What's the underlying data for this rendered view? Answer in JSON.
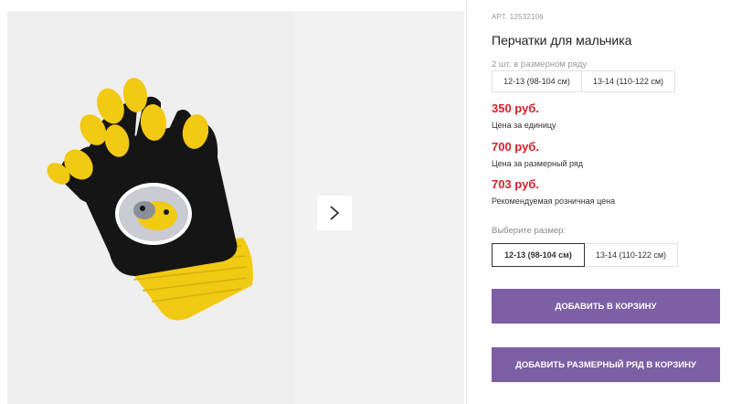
{
  "product": {
    "article": "АРТ. 12532106",
    "title": "Перчатки для мальчика",
    "pack": {
      "label": "2 шт. в размерном ряду",
      "sizes": [
        "12-13 (98-104 см)",
        "13-14 (110-122 см)"
      ]
    },
    "prices": [
      {
        "value": "350 руб.",
        "note": "Цена за единицу"
      },
      {
        "value": "700 руб.",
        "note": "Цена за размерный ряд"
      },
      {
        "value": "703 руб.",
        "note": "Рекомендуемая розничная цена"
      }
    ],
    "size_select": {
      "label": "Выберите размер:",
      "options": [
        "12-13 (98-104 см)",
        "13-14 (110-122 см)"
      ],
      "selected": "12-13 (98-104 см)"
    },
    "buttons": {
      "add_to_cart": "ДОБАВИТЬ В КОРЗИНУ",
      "add_pack_to_cart": "ДОБАВИТЬ РАЗМЕРНЫЙ РЯД В КОРЗИНУ"
    }
  },
  "gallery": {
    "next_icon": "chevron-right-icon",
    "image_icon": "glove-product-image"
  },
  "colors": {
    "price": "#d6202c",
    "button": "#7d5fa5",
    "glove_black": "#151515",
    "glove_yellow": "#f2c913"
  }
}
